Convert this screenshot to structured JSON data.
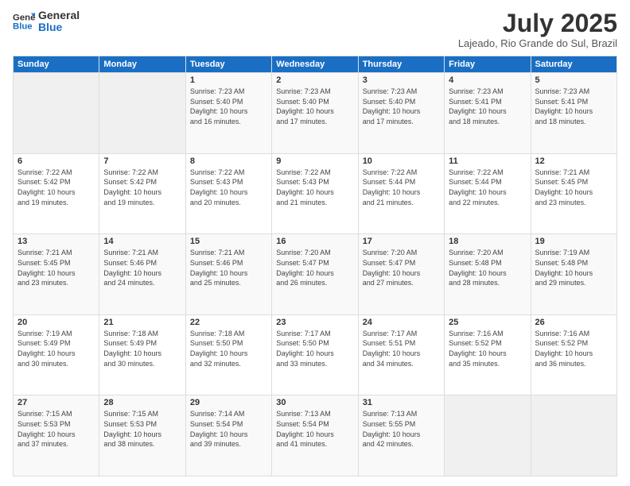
{
  "header": {
    "logo_line1": "General",
    "logo_line2": "Blue",
    "month_title": "July 2025",
    "location": "Lajeado, Rio Grande do Sul, Brazil"
  },
  "weekdays": [
    "Sunday",
    "Monday",
    "Tuesday",
    "Wednesday",
    "Thursday",
    "Friday",
    "Saturday"
  ],
  "weeks": [
    [
      {
        "day": "",
        "info": ""
      },
      {
        "day": "",
        "info": ""
      },
      {
        "day": "1",
        "info": "Sunrise: 7:23 AM\nSunset: 5:40 PM\nDaylight: 10 hours\nand 16 minutes."
      },
      {
        "day": "2",
        "info": "Sunrise: 7:23 AM\nSunset: 5:40 PM\nDaylight: 10 hours\nand 17 minutes."
      },
      {
        "day": "3",
        "info": "Sunrise: 7:23 AM\nSunset: 5:40 PM\nDaylight: 10 hours\nand 17 minutes."
      },
      {
        "day": "4",
        "info": "Sunrise: 7:23 AM\nSunset: 5:41 PM\nDaylight: 10 hours\nand 18 minutes."
      },
      {
        "day": "5",
        "info": "Sunrise: 7:23 AM\nSunset: 5:41 PM\nDaylight: 10 hours\nand 18 minutes."
      }
    ],
    [
      {
        "day": "6",
        "info": "Sunrise: 7:22 AM\nSunset: 5:42 PM\nDaylight: 10 hours\nand 19 minutes."
      },
      {
        "day": "7",
        "info": "Sunrise: 7:22 AM\nSunset: 5:42 PM\nDaylight: 10 hours\nand 19 minutes."
      },
      {
        "day": "8",
        "info": "Sunrise: 7:22 AM\nSunset: 5:43 PM\nDaylight: 10 hours\nand 20 minutes."
      },
      {
        "day": "9",
        "info": "Sunrise: 7:22 AM\nSunset: 5:43 PM\nDaylight: 10 hours\nand 21 minutes."
      },
      {
        "day": "10",
        "info": "Sunrise: 7:22 AM\nSunset: 5:44 PM\nDaylight: 10 hours\nand 21 minutes."
      },
      {
        "day": "11",
        "info": "Sunrise: 7:22 AM\nSunset: 5:44 PM\nDaylight: 10 hours\nand 22 minutes."
      },
      {
        "day": "12",
        "info": "Sunrise: 7:21 AM\nSunset: 5:45 PM\nDaylight: 10 hours\nand 23 minutes."
      }
    ],
    [
      {
        "day": "13",
        "info": "Sunrise: 7:21 AM\nSunset: 5:45 PM\nDaylight: 10 hours\nand 23 minutes."
      },
      {
        "day": "14",
        "info": "Sunrise: 7:21 AM\nSunset: 5:46 PM\nDaylight: 10 hours\nand 24 minutes."
      },
      {
        "day": "15",
        "info": "Sunrise: 7:21 AM\nSunset: 5:46 PM\nDaylight: 10 hours\nand 25 minutes."
      },
      {
        "day": "16",
        "info": "Sunrise: 7:20 AM\nSunset: 5:47 PM\nDaylight: 10 hours\nand 26 minutes."
      },
      {
        "day": "17",
        "info": "Sunrise: 7:20 AM\nSunset: 5:47 PM\nDaylight: 10 hours\nand 27 minutes."
      },
      {
        "day": "18",
        "info": "Sunrise: 7:20 AM\nSunset: 5:48 PM\nDaylight: 10 hours\nand 28 minutes."
      },
      {
        "day": "19",
        "info": "Sunrise: 7:19 AM\nSunset: 5:48 PM\nDaylight: 10 hours\nand 29 minutes."
      }
    ],
    [
      {
        "day": "20",
        "info": "Sunrise: 7:19 AM\nSunset: 5:49 PM\nDaylight: 10 hours\nand 30 minutes."
      },
      {
        "day": "21",
        "info": "Sunrise: 7:18 AM\nSunset: 5:49 PM\nDaylight: 10 hours\nand 30 minutes."
      },
      {
        "day": "22",
        "info": "Sunrise: 7:18 AM\nSunset: 5:50 PM\nDaylight: 10 hours\nand 32 minutes."
      },
      {
        "day": "23",
        "info": "Sunrise: 7:17 AM\nSunset: 5:50 PM\nDaylight: 10 hours\nand 33 minutes."
      },
      {
        "day": "24",
        "info": "Sunrise: 7:17 AM\nSunset: 5:51 PM\nDaylight: 10 hours\nand 34 minutes."
      },
      {
        "day": "25",
        "info": "Sunrise: 7:16 AM\nSunset: 5:52 PM\nDaylight: 10 hours\nand 35 minutes."
      },
      {
        "day": "26",
        "info": "Sunrise: 7:16 AM\nSunset: 5:52 PM\nDaylight: 10 hours\nand 36 minutes."
      }
    ],
    [
      {
        "day": "27",
        "info": "Sunrise: 7:15 AM\nSunset: 5:53 PM\nDaylight: 10 hours\nand 37 minutes."
      },
      {
        "day": "28",
        "info": "Sunrise: 7:15 AM\nSunset: 5:53 PM\nDaylight: 10 hours\nand 38 minutes."
      },
      {
        "day": "29",
        "info": "Sunrise: 7:14 AM\nSunset: 5:54 PM\nDaylight: 10 hours\nand 39 minutes."
      },
      {
        "day": "30",
        "info": "Sunrise: 7:13 AM\nSunset: 5:54 PM\nDaylight: 10 hours\nand 41 minutes."
      },
      {
        "day": "31",
        "info": "Sunrise: 7:13 AM\nSunset: 5:55 PM\nDaylight: 10 hours\nand 42 minutes."
      },
      {
        "day": "",
        "info": ""
      },
      {
        "day": "",
        "info": ""
      }
    ]
  ]
}
